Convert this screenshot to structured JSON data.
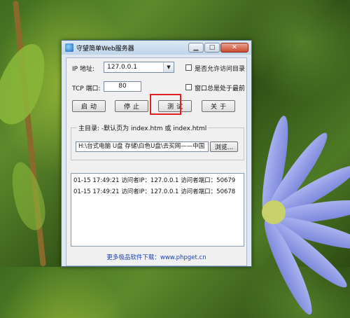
{
  "window": {
    "title": "守望简单Web服务器",
    "minimize_glyph": "▁",
    "maximize_glyph": "□",
    "close_glyph": "✕"
  },
  "form": {
    "ip_label": "IP 地址:",
    "ip_value": "127.0.0.1",
    "port_label": "TCP 端口:",
    "port_value": "80",
    "allow_dir_label": "是否允许访问目录",
    "always_top_label": "窗口总是处于最前"
  },
  "buttons": {
    "start": "启动",
    "stop": "停止",
    "test": "测试",
    "about": "关于"
  },
  "root_dir": {
    "legend": "主目录: -默认页为 index.htm 或 index.html",
    "path": "H:\\台式电脑 U盘 存储\\白色U盘\\去买网——中国",
    "browse_label": "浏览..."
  },
  "log": {
    "lines": [
      "01-15 17:49:21 访问者IP：127.0.0.1  访问者端口：50679",
      "01-15 17:49:21 访问者IP：127.0.0.1  访问者端口：50678"
    ]
  },
  "footer": {
    "text": "更多极品软件下载：www.phpget.cn"
  },
  "colors": {
    "highlight": "#e02020",
    "footer_link": "#1a3fb5"
  }
}
